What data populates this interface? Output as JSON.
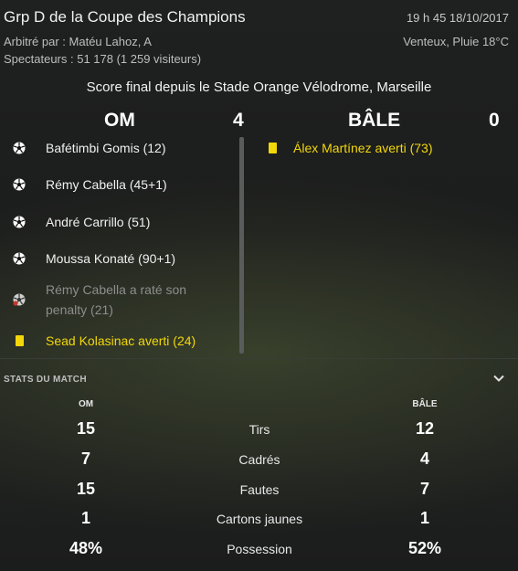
{
  "header": {
    "title": "Grp D de la Coupe des Champions",
    "datetime": "19 h 45 18/10/2017",
    "referee": "Arbitré par : Matéu Lahoz, A",
    "weather": "Venteux, Pluie 18°C",
    "spectators": "Spectateurs : 51 178 (1 259 visiteurs)",
    "venue": "Score final depuis le Stade Orange Vélodrome, Marseille"
  },
  "score": {
    "home_team": "OM",
    "home_goals": "4",
    "away_team": "BÂLE",
    "away_goals": "0"
  },
  "home_events": [
    {
      "type": "goal",
      "icon": "football-icon",
      "text": "Bafétimbi Gomis (12)"
    },
    {
      "type": "goal",
      "icon": "football-icon",
      "text": "Rémy Cabella (45+1)"
    },
    {
      "type": "goal",
      "icon": "football-icon",
      "text": "André Carrillo (51)"
    },
    {
      "type": "goal",
      "icon": "football-icon",
      "text": "Moussa Konaté (90+1)"
    },
    {
      "type": "missed-penalty",
      "icon": "missed-penalty-icon",
      "text": "Rémy Cabella a raté son penalty (21)"
    },
    {
      "type": "yellow-card",
      "icon": "yellow-card-icon",
      "text": "Sead Kolasinac averti (24)"
    }
  ],
  "away_events": [
    {
      "type": "yellow-card",
      "icon": "yellow-card-icon",
      "text": "Álex Martínez averti (73)"
    }
  ],
  "stats": {
    "section_label": "STATS DU MATCH",
    "home_label": "OM",
    "away_label": "BÂLE",
    "rows": [
      {
        "label": "Tirs",
        "home": "15",
        "away": "12"
      },
      {
        "label": "Cadrés",
        "home": "7",
        "away": "4"
      },
      {
        "label": "Fautes",
        "home": "15",
        "away": "7"
      },
      {
        "label": "Cartons jaunes",
        "home": "1",
        "away": "1"
      },
      {
        "label": "Possession",
        "home": "48%",
        "away": "52%"
      }
    ]
  },
  "colors": {
    "yellow_card": "#f2d70a",
    "background": "#1c1d1d"
  }
}
